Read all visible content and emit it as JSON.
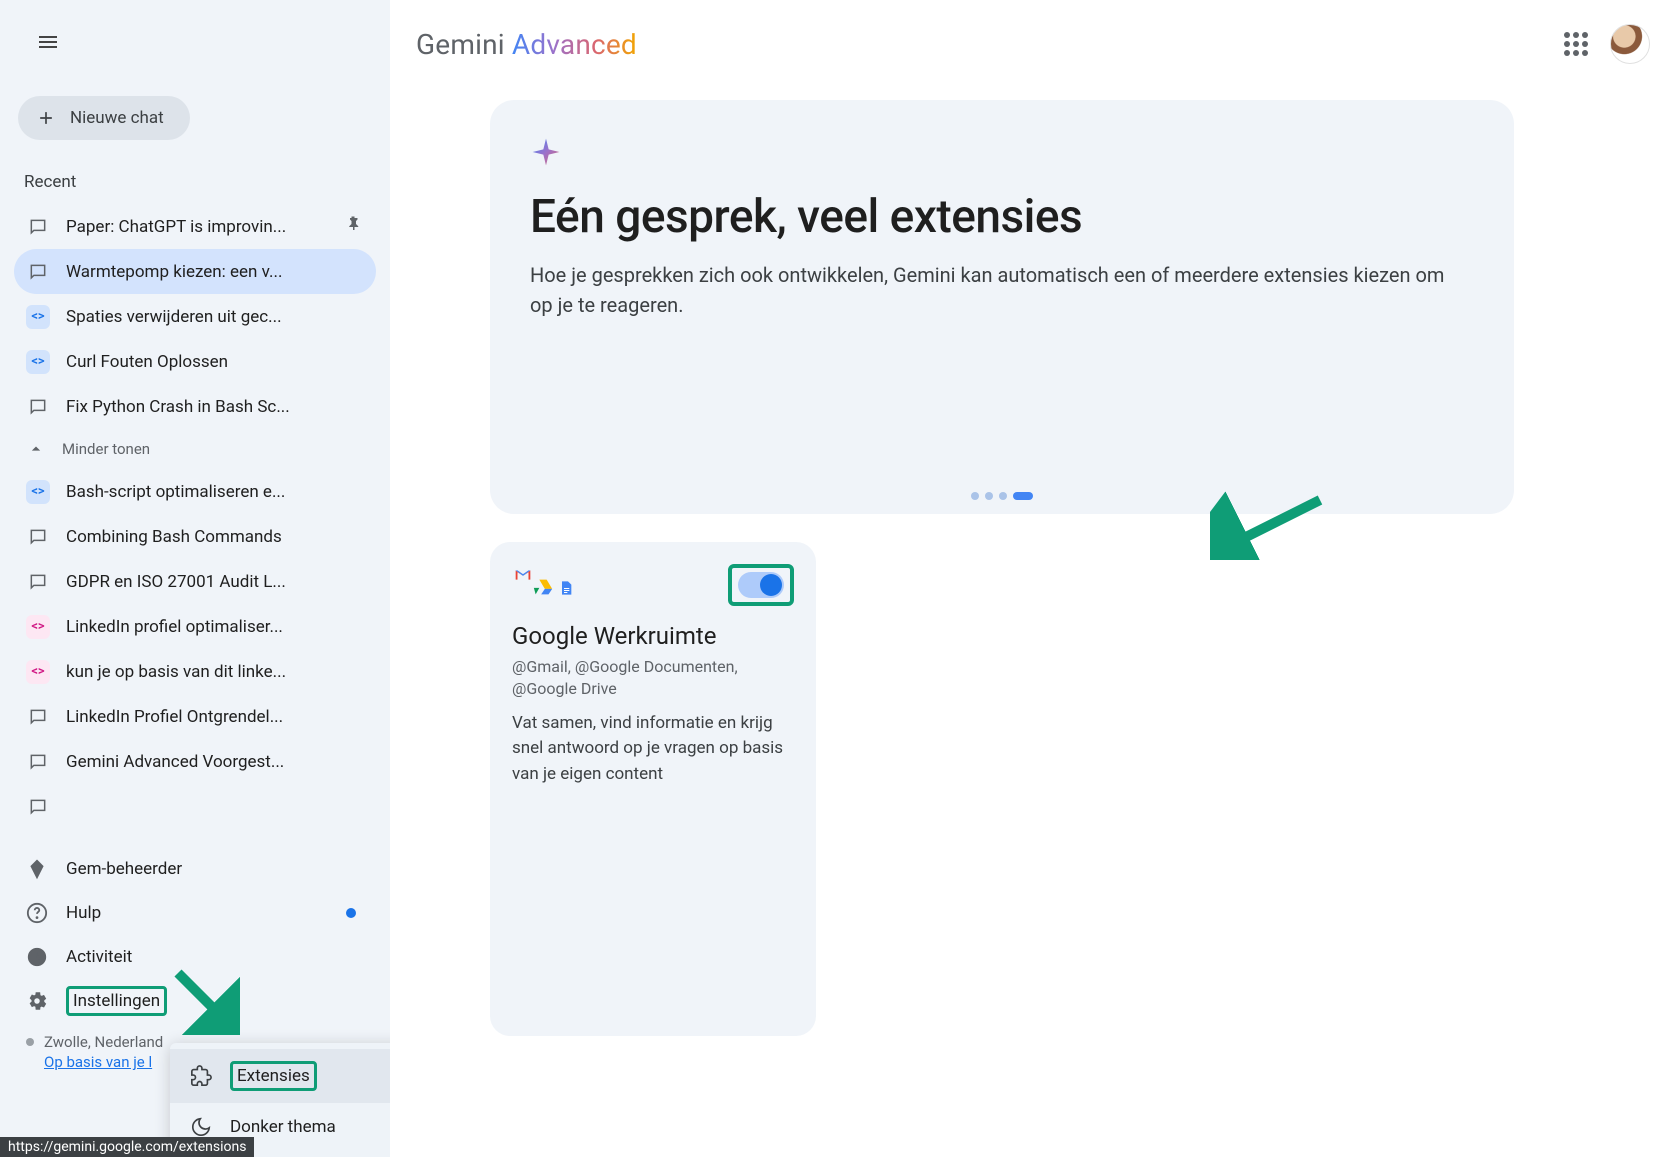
{
  "brand": {
    "name": "Gemini",
    "tier": "Advanced"
  },
  "sidebar": {
    "new_chat": "Nieuwe chat",
    "recent_label": "Recent",
    "show_less": "Minder tonen",
    "items_top": [
      {
        "label": "Paper: ChatGPT is improvin...",
        "icon": "chat",
        "pinned": true
      },
      {
        "label": "Warmtepomp kiezen: een v...",
        "icon": "chat",
        "active": true
      },
      {
        "label": "Spaties verwijderen uit gec...",
        "icon": "code-blue"
      },
      {
        "label": "Curl Fouten Oplossen",
        "icon": "code-blue"
      },
      {
        "label": "Fix Python Crash in Bash Sc...",
        "icon": "chat"
      }
    ],
    "items_more": [
      {
        "label": "Bash-script optimaliseren e...",
        "icon": "code-blue"
      },
      {
        "label": "Combining Bash Commands",
        "icon": "chat"
      },
      {
        "label": "GDPR en ISO 27001 Audit L...",
        "icon": "chat"
      },
      {
        "label": "LinkedIn profiel optimaliser...",
        "icon": "code-pink"
      },
      {
        "label": "kun je op basis van dit linke...",
        "icon": "code-pink"
      },
      {
        "label": "LinkedIn Profiel Ontgrendel...",
        "icon": "chat"
      },
      {
        "label": "Gemini Advanced Voorgest...",
        "icon": "chat"
      },
      {
        "label": "",
        "icon": "chat",
        "redacted": true
      }
    ],
    "bottom": {
      "gem": "Gem-beheerder",
      "help": "Hulp",
      "activity": "Activiteit",
      "settings": "Instellingen"
    },
    "location": {
      "city": "Zwolle, Nederland",
      "basis": "Op basis van je l"
    }
  },
  "popup": {
    "extensions": "Extensies",
    "dark_theme": "Donker thema"
  },
  "hero": {
    "title": "Eén gesprek, veel extensies",
    "body": "Hoe je gesprekken zich ook ontwikkelen, Gemini kan automatisch een of meerdere extensies kiezen om op je te reageren."
  },
  "card": {
    "title": "Google Werkruimte",
    "subtitle": "@Gmail, @Google Documenten, @Google Drive",
    "desc": "Vat samen, vind informatie en krijg snel antwoord op je vragen op basis van je eigen content"
  },
  "status_url": "https://gemini.google.com/extensions"
}
